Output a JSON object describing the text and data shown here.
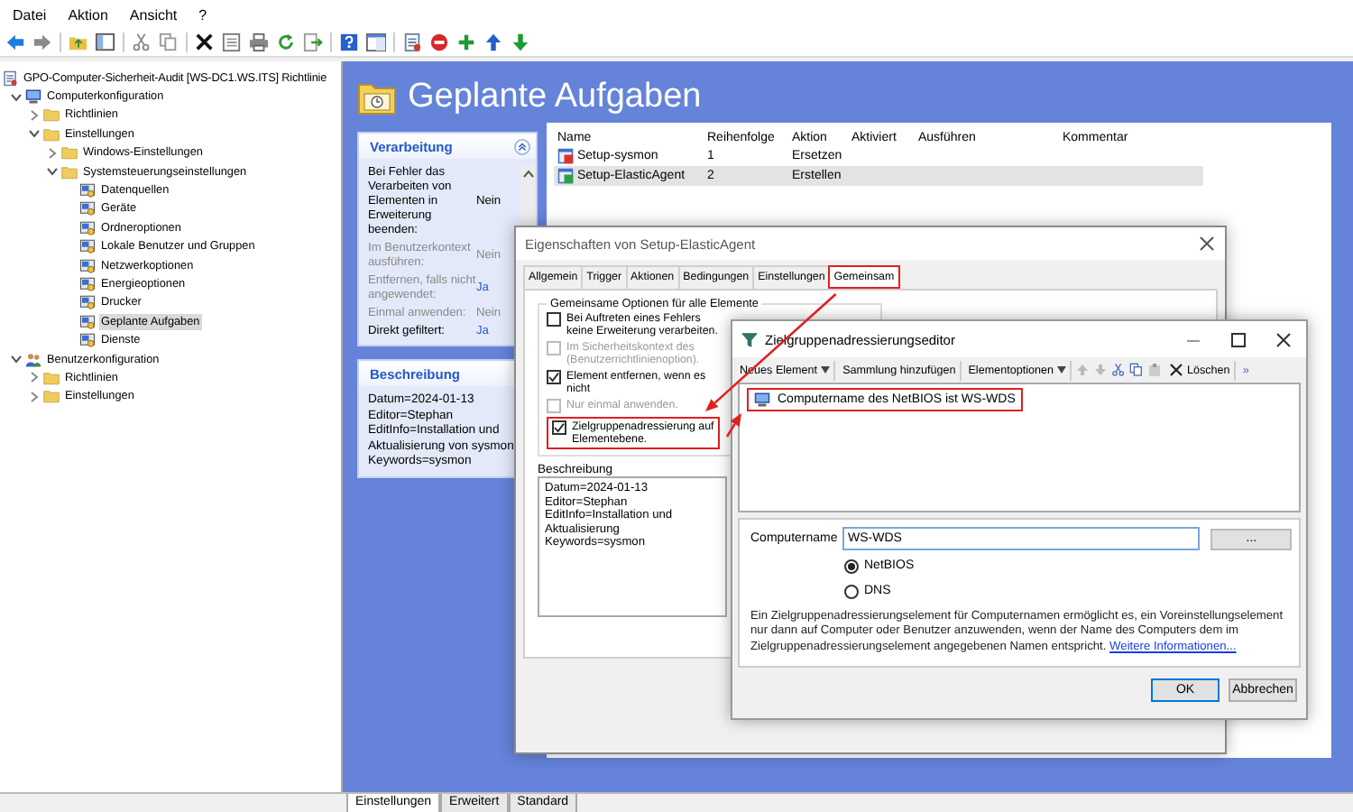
{
  "menu_bar": [
    "Datei",
    "Aktion",
    "Ansicht",
    "?"
  ],
  "tree": [
    {
      "label": "GPO-Computer-Sicherheit-Audit [WS-DC1.WS.ITS] Richtlinie",
      "kind": "root",
      "selected": false,
      "children": [
        {
          "label": "Computerkonfiguration",
          "kind": "computer",
          "expanded": true,
          "selected": false,
          "children": [
            {
              "label": "Richtlinien",
              "kind": "folder",
              "expanded": false,
              "selected": false
            },
            {
              "label": "Einstellungen",
              "kind": "folder",
              "expanded": true,
              "selected": false,
              "children": [
                {
                  "label": "Windows-Einstellungen",
                  "kind": "folder",
                  "expanded": false,
                  "selected": false
                },
                {
                  "label": "Systemsteuerungseinstellungen",
                  "kind": "folder",
                  "expanded": true,
                  "selected": false,
                  "children": [
                    {
                      "label": "Datenquellen",
                      "kind": "setting",
                      "selected": false
                    },
                    {
                      "label": "Geräte",
                      "kind": "setting",
                      "selected": false
                    },
                    {
                      "label": "Ordneroptionen",
                      "kind": "setting",
                      "selected": false
                    },
                    {
                      "label": "Lokale Benutzer und Gruppen",
                      "kind": "setting",
                      "selected": false
                    },
                    {
                      "label": "Netzwerkoptionen",
                      "kind": "setting",
                      "selected": false
                    },
                    {
                      "label": "Energieoptionen",
                      "kind": "setting",
                      "selected": false
                    },
                    {
                      "label": "Drucker",
                      "kind": "setting",
                      "selected": false
                    },
                    {
                      "label": "Geplante Aufgaben",
                      "kind": "setting",
                      "selected": true
                    },
                    {
                      "label": "Dienste",
                      "kind": "setting",
                      "selected": false
                    }
                  ]
                }
              ]
            }
          ]
        },
        {
          "label": "Benutzerkonfiguration",
          "kind": "user",
          "expanded": true,
          "selected": false,
          "children": [
            {
              "label": "Richtlinien",
              "kind": "folder",
              "expanded": false,
              "selected": false
            },
            {
              "label": "Einstellungen",
              "kind": "folder",
              "expanded": false,
              "selected": false
            }
          ]
        }
      ]
    }
  ],
  "header": {
    "title": "Geplante Aufgaben"
  },
  "processing_panel": {
    "title": "Verarbeitung",
    "rows": [
      {
        "label": "Bei Fehler das Verarbeiten von Elementen in Erweiterung beenden:",
        "value": "Nein",
        "dimmed": false,
        "highlighted": false
      },
      {
        "label": "Im Benutzerkontext ausführen:",
        "value": "Nein",
        "dimmed": true,
        "highlighted": false
      },
      {
        "label": "Entfernen, falls nicht angewendet:",
        "value": "Ja",
        "dimmed": true,
        "highlighted": true
      },
      {
        "label": "Einmal anwenden:",
        "value": "Nein",
        "dimmed": true,
        "highlighted": false
      },
      {
        "label": "Direkt gefiltert:",
        "value": "Ja",
        "dimmed": false,
        "highlighted": true
      }
    ]
  },
  "description_panel": {
    "title": "Beschreibung",
    "lines": [
      "Datum=2024-01-13",
      "Editor=Stephan",
      "EditInfo=Installation und Aktualisierung von sysmon",
      "Keywords=sysmon"
    ]
  },
  "table": {
    "columns": [
      "Name",
      "Reihenfolge",
      "Aktion",
      "Aktiviert",
      "Ausführen",
      "Kommentar"
    ],
    "rows": [
      {
        "cells": [
          "Setup-sysmon",
          "1",
          "Ersetzen"
        ],
        "kind": "replace",
        "selected": false
      },
      {
        "cells": [
          "Setup-ElasticAgent",
          "2",
          "Erstellen"
        ],
        "kind": "create",
        "selected": true
      }
    ]
  },
  "bottom_tabs": [
    {
      "label": "Einstellungen",
      "selected": true
    },
    {
      "label": "Erweitert",
      "selected": false
    },
    {
      "label": "Standard",
      "selected": false
    }
  ],
  "properties_dialog": {
    "title": "Eigenschaften von Setup-ElasticAgent",
    "tabs": [
      {
        "label": "Allgemein",
        "selected": false,
        "highlighted": false
      },
      {
        "label": "Trigger",
        "selected": false,
        "highlighted": false
      },
      {
        "label": "Aktionen",
        "selected": false,
        "highlighted": false
      },
      {
        "label": "Bedingungen",
        "selected": false,
        "highlighted": false
      },
      {
        "label": "Einstellungen",
        "selected": false,
        "highlighted": false
      },
      {
        "label": "Gemeinsam",
        "selected": true,
        "highlighted": true
      }
    ],
    "group_title": "Gemeinsame Optionen für alle Elemente",
    "options": [
      {
        "label": "Bei Auftreten eines Fehlers keine Erweiterung verarbeiten.",
        "checked": false,
        "disabled": false,
        "highlighted": false
      },
      {
        "label": "Im Sicherheitskontext des (Benutzerrichtlinienoption).",
        "checked": false,
        "disabled": true,
        "highlighted": false
      },
      {
        "label": "Element entfernen, wenn es nicht",
        "checked": true,
        "disabled": false,
        "highlighted": false
      },
      {
        "label": "Nur einmal anwenden.",
        "checked": false,
        "disabled": true,
        "highlighted": false
      },
      {
        "label": "Zielgruppenadressierung auf Elementebene.",
        "checked": true,
        "disabled": false,
        "highlighted": true
      }
    ],
    "description_label": "Beschreibung",
    "description_lines": [
      "Datum=2024-01-13",
      "Editor=Stephan",
      "EditInfo=Installation und Aktualisierung",
      "Keywords=sysmon"
    ]
  },
  "targeting_editor": {
    "title": "Zielgruppenadressierungseditor",
    "toolbar": [
      {
        "kind": "dropdown",
        "label": "Neues Element"
      },
      {
        "kind": "button",
        "label": "Sammlung hinzufügen"
      },
      {
        "kind": "dropdown",
        "label": "Elementoptionen"
      },
      {
        "kind": "move-up"
      },
      {
        "kind": "move-down"
      },
      {
        "kind": "cut"
      },
      {
        "kind": "copy"
      },
      {
        "kind": "paste"
      },
      {
        "kind": "delete",
        "label": "Löschen"
      },
      {
        "kind": "overflow",
        "label": "»"
      }
    ],
    "items": [
      {
        "label": "Computername des NetBIOS ist WS-WDS",
        "highlighted": true
      }
    ],
    "field_label": "Computername",
    "field_value": "WS-WDS",
    "browse_label": "...",
    "radios": [
      {
        "label": "NetBIOS",
        "selected": true
      },
      {
        "label": "DNS",
        "selected": false
      }
    ],
    "help_text": "Ein Zielgruppenadressierungselement für Computernamen ermöglicht es, ein Voreinstellungselement nur dann auf Computer oder Benutzer anzuwenden, wenn der Name des Computers dem im Zielgruppenadressierungselement angegebenen Namen entspricht.",
    "help_link": "Weitere Informationen...",
    "buttons": [
      {
        "label": "OK",
        "default": true
      },
      {
        "label": "Abbrechen",
        "default": false
      }
    ]
  }
}
